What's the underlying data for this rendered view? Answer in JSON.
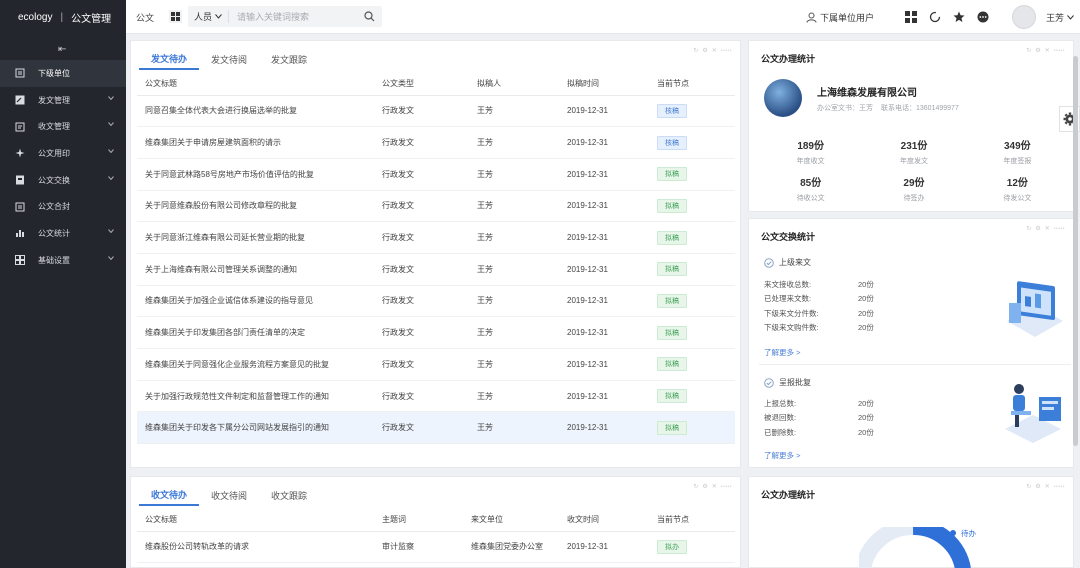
{
  "topbar": {
    "brand": "ecology",
    "module": "公文管理",
    "current": "公文",
    "search_scope": "人员",
    "search_placeholder": "请输入关键词搜索",
    "sub_user": "下属单位用户",
    "user_name": "王芳"
  },
  "sidebar": {
    "items": [
      {
        "label": "下级单位",
        "icon": "building-icon",
        "active": true
      },
      {
        "label": "发文管理",
        "icon": "edit-doc-icon"
      },
      {
        "label": "收文管理",
        "icon": "inbox-doc-icon"
      },
      {
        "label": "公文用印",
        "icon": "seal-icon"
      },
      {
        "label": "公文交换",
        "icon": "exchange-icon"
      },
      {
        "label": "公文合封",
        "icon": "envelope-icon"
      },
      {
        "label": "公文统计",
        "icon": "bar-chart-icon"
      },
      {
        "label": "基础设置",
        "icon": "settings-grid-icon"
      }
    ]
  },
  "send_panel": {
    "tabs": [
      "发文待办",
      "发文待阅",
      "发文跟踪"
    ],
    "columns": [
      "公文标题",
      "公文类型",
      "拟稿人",
      "拟稿时间",
      "当前节点"
    ],
    "rows": [
      {
        "title": "同意召集全体代表大会进行换届选举的批复",
        "type": "行政发文",
        "author": "王芳",
        "date": "2019-12-31",
        "node": "核稿",
        "color": "blue"
      },
      {
        "title": "维森集团关于申请房屋建筑面积的请示",
        "type": "行政发文",
        "author": "王芳",
        "date": "2019-12-31",
        "node": "核稿",
        "color": "blue"
      },
      {
        "title": "关于同意武林路58号房地产市场价值评估的批复",
        "type": "行政发文",
        "author": "王芳",
        "date": "2019-12-31",
        "node": "拟稿",
        "color": "green"
      },
      {
        "title": "关于同意维森股份有限公司修改章程的批复",
        "type": "行政发文",
        "author": "王芳",
        "date": "2019-12-31",
        "node": "拟稿",
        "color": "green"
      },
      {
        "title": "关于同意浙江维森有限公司延长营业期的批复",
        "type": "行政发文",
        "author": "王芳",
        "date": "2019-12-31",
        "node": "拟稿",
        "color": "green"
      },
      {
        "title": "关于上海维森有限公司管理关系调整的通知",
        "type": "行政发文",
        "author": "王芳",
        "date": "2019-12-31",
        "node": "拟稿",
        "color": "green"
      },
      {
        "title": "维森集团关于加强企业诚信体系建设的指导意见",
        "type": "行政发文",
        "author": "王芳",
        "date": "2019-12-31",
        "node": "拟稿",
        "color": "green"
      },
      {
        "title": "维森集团关于印发集团各部门责任清单的决定",
        "type": "行政发文",
        "author": "王芳",
        "date": "2019-12-31",
        "node": "拟稿",
        "color": "green"
      },
      {
        "title": "维森集团关于同意强化企业服务流程方案意见的批复",
        "type": "行政发文",
        "author": "王芳",
        "date": "2019-12-31",
        "node": "拟稿",
        "color": "green"
      },
      {
        "title": "关于加强行政规范性文件制定和监督管理工作的通知",
        "type": "行政发文",
        "author": "王芳",
        "date": "2019-12-31",
        "node": "拟稿",
        "color": "green"
      },
      {
        "title": "维森集团关于印发各下属分公司网站发展指引的通知",
        "type": "行政发文",
        "author": "王芳",
        "date": "2019-12-31",
        "node": "拟稿",
        "color": "green"
      }
    ]
  },
  "recv_panel": {
    "tabs": [
      "收文待办",
      "收文待阅",
      "收文跟踪"
    ],
    "columns": [
      "公文标题",
      "主题词",
      "来文单位",
      "收文时间",
      "当前节点"
    ],
    "rows": [
      {
        "title": "维森股份公司转轨改革的请求",
        "keyword": "审计监察",
        "unit": "维森集团党委办公室",
        "date": "2019-12-31",
        "node": "拟办",
        "color": "green"
      }
    ]
  },
  "stats_panel": {
    "title": "公文办理统计",
    "company": "上海维森发展有限公司",
    "contact_label": "办公室文书：",
    "contact_name": "王芳",
    "phone_label": "联系电话：",
    "phone": "13601499977",
    "stats": [
      {
        "num": "189份",
        "label": "年度收文"
      },
      {
        "num": "231份",
        "label": "年度发文"
      },
      {
        "num": "349份",
        "label": "年度签报"
      },
      {
        "num": "85份",
        "label": "待收公文"
      },
      {
        "num": "29份",
        "label": "待签办"
      },
      {
        "num": "12份",
        "label": "待发公文"
      }
    ]
  },
  "exchange_panel": {
    "title": "公文交换统计",
    "sec1_title": "上级来文",
    "sec1_items": [
      {
        "k": "来文接收总数:",
        "v": "20份"
      },
      {
        "k": "已处理来文数:",
        "v": "20份"
      },
      {
        "k": "下级来文分件数:",
        "v": "20份"
      },
      {
        "k": "下级来文购件数:",
        "v": "20份"
      }
    ],
    "sec2_title": "呈报批复",
    "sec2_items": [
      {
        "k": "上报总数:",
        "v": "20份"
      },
      {
        "k": "被退回数:",
        "v": "20份"
      },
      {
        "k": "已删除数:",
        "v": "20份"
      }
    ],
    "more_link": "了解更多 >"
  },
  "bottom_stats_panel": {
    "title": "公文办理统计",
    "legend_item": "待办"
  },
  "colors": {
    "accent": "#3c78d8",
    "sidebar_bg": "#23262d",
    "badge_green": "#43a35a",
    "badge_blue": "#4a7fd4"
  }
}
